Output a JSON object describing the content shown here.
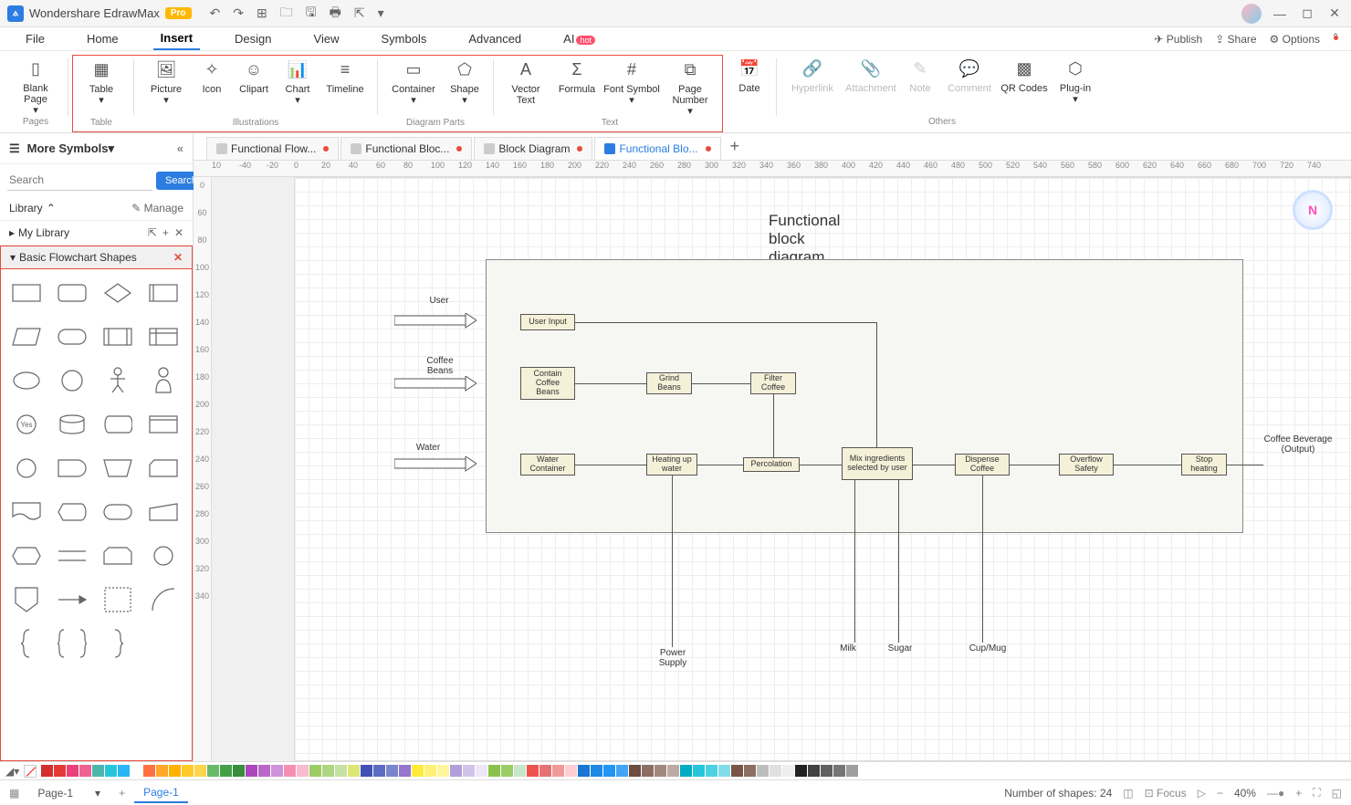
{
  "app": {
    "title": "Wondershare EdrawMax",
    "pro": "Pro"
  },
  "menubar": {
    "items": [
      "File",
      "Home",
      "Insert",
      "Design",
      "View",
      "Symbols",
      "Advanced",
      "AI"
    ],
    "active": "Insert",
    "hot": "hot",
    "right": {
      "publish": "Publish",
      "share": "Share",
      "options": "Options"
    }
  },
  "ribbon": {
    "blank_page": "Blank Page",
    "groups": {
      "table": {
        "label": "Table",
        "items": [
          "Table"
        ]
      },
      "illustrations": {
        "label": "Illustrations",
        "items": [
          "Picture",
          "Icon",
          "Clipart",
          "Chart",
          "Timeline"
        ]
      },
      "diagram_parts": {
        "label": "Diagram Parts",
        "items": [
          "Container",
          "Shape"
        ]
      },
      "text": {
        "label": "Text",
        "items": [
          "Vector Text",
          "Formula",
          "Font Symbol",
          "Page Number"
        ]
      },
      "date": "Date",
      "others": {
        "label": "Others",
        "items": [
          "Hyperlink",
          "Attachment",
          "Note",
          "Comment",
          "QR Codes",
          "Plug-in"
        ]
      }
    },
    "pages_label": "Pages"
  },
  "left_panel": {
    "title": "More Symbols",
    "search_placeholder": "Search",
    "search_btn": "Search",
    "library": "Library",
    "manage": "Manage",
    "my_library": "My Library",
    "section": "Basic Flowchart Shapes"
  },
  "tabs": [
    {
      "label": "Functional Flow...",
      "dirty": true,
      "active": false
    },
    {
      "label": "Functional Bloc...",
      "dirty": true,
      "active": false
    },
    {
      "label": "Block Diagram",
      "dirty": true,
      "active": false
    },
    {
      "label": "Functional Blo...",
      "dirty": true,
      "active": true
    }
  ],
  "ruler_h": [
    "10",
    "-40",
    "-20",
    "0",
    "20",
    "40",
    "60",
    "80",
    "100",
    "120",
    "140",
    "160",
    "180",
    "200",
    "220",
    "240",
    "260",
    "280",
    "300",
    "320",
    "340",
    "360",
    "380",
    "400",
    "420",
    "440",
    "460",
    "480",
    "500",
    "520",
    "540",
    "560",
    "580",
    "600",
    "620",
    "640",
    "660",
    "680",
    "700",
    "720",
    "740"
  ],
  "ruler_v": [
    "0",
    "60",
    "80",
    "100",
    "120",
    "140",
    "160",
    "180",
    "200",
    "220",
    "240",
    "260",
    "280",
    "300",
    "320",
    "340"
  ],
  "diagram": {
    "title": "Functional block diagram",
    "inputs": {
      "user": "User",
      "beans": "Coffee Beans",
      "water": "Water"
    },
    "boxes": {
      "user_input": "User Input",
      "contain": "Contain Coffee Beans",
      "grind": "Grind Beans",
      "filter": "Filter Coffee",
      "water_c": "Water Container",
      "heat": "Heating up water",
      "perc": "Percolation",
      "mix": "Mix ingredients selected by user",
      "dispense": "Dispense Coffee",
      "overflow": "Overflow Safety",
      "stop": "Stop heating"
    },
    "outputs": {
      "power": "Power Supply",
      "milk": "Milk",
      "sugar": "Sugar",
      "cup": "Cup/Mug",
      "coffee": "Coffee Beverage (Output)"
    }
  },
  "colors": [
    "#d32f2f",
    "#e53935",
    "#ec407a",
    "#f06292",
    "#4db6ac",
    "#26c6da",
    "#29b6f6",
    "#ffffff",
    "#ff7043",
    "#ffa726",
    "#ffb300",
    "#ffca28",
    "#ffd54f",
    "#66bb6a",
    "#43a047",
    "#388e3c",
    "#ab47bc",
    "#ba68c8",
    "#ce93d8",
    "#f48fb1",
    "#f8bbd0",
    "#9ccc65",
    "#aed581",
    "#c5e1a5",
    "#dce775",
    "#3f51b5",
    "#5c6bc0",
    "#7986cb",
    "#9575cd",
    "#ffeb3b",
    "#fff176",
    "#fff59d",
    "#b39ddb",
    "#d1c4e9",
    "#ede7f6",
    "#8bc34a",
    "#9ccc65",
    "#c8e6c9",
    "#ef5350",
    "#e57373",
    "#ef9a9a",
    "#ffcdd2",
    "#1976d2",
    "#1e88e5",
    "#2196f3",
    "#42a5f5",
    "#6d4c41",
    "#8d6e63",
    "#a1887f",
    "#bcaaa4",
    "#00acc1",
    "#26c6da",
    "#4dd0e1",
    "#80deea",
    "#795548",
    "#8d6e63",
    "#bdbdbd",
    "#e0e0e0",
    "#eeeeee",
    "#212121",
    "#424242",
    "#616161",
    "#757575",
    "#9e9e9e"
  ],
  "status": {
    "page_left": "Page-1",
    "page_tab": "Page-1",
    "shapes": "Number of shapes: 24",
    "focus": "Focus",
    "zoom": "40%"
  }
}
